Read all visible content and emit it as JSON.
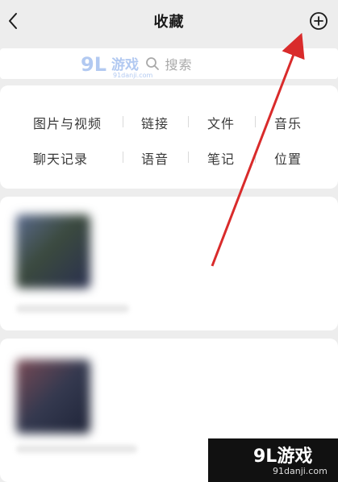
{
  "header": {
    "title": "收藏"
  },
  "search": {
    "placeholder": "搜索"
  },
  "categories": {
    "row1": [
      "图片与视频",
      "链接",
      "文件",
      "音乐"
    ],
    "row2": [
      "聊天记录",
      "语音",
      "笔记",
      "位置"
    ]
  },
  "watermark": {
    "brand": "9L游戏",
    "site": "91danji.com"
  },
  "colors": {
    "background": "#ededed",
    "card": "#ffffff",
    "annotation_arrow": "#d92b2b"
  }
}
